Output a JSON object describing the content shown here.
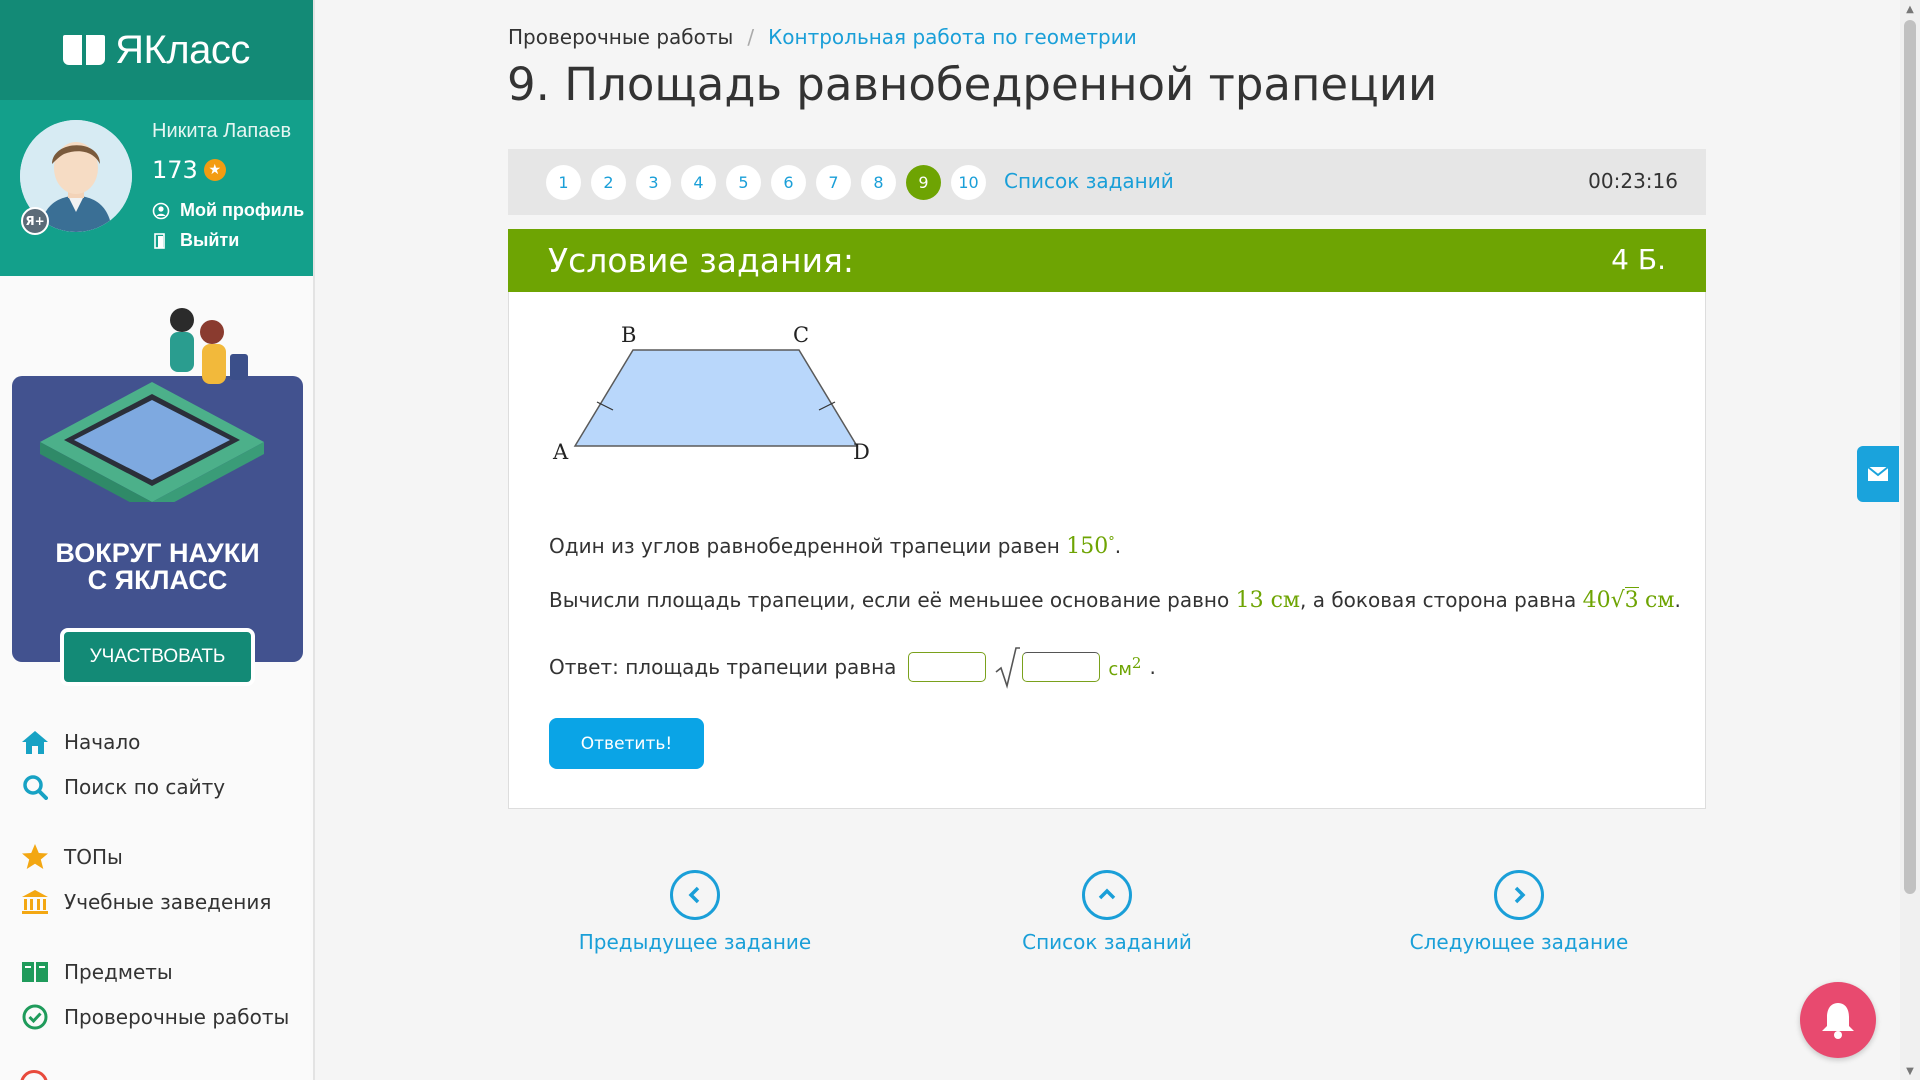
{
  "app": {
    "logo_text": "ЯКласс"
  },
  "user": {
    "name": "Никита Лапаев",
    "points": "173",
    "badge": "Я+",
    "profile_link": "Мой профиль",
    "logout_link": "Выйти"
  },
  "promo": {
    "title_line1": "ВОКРУГ НАУКИ",
    "title_line2": "С ЯКЛАСС",
    "button": "УЧАСТВОВАТЬ"
  },
  "nav": {
    "home": "Начало",
    "search": "Поиск по сайту",
    "tops": "ТОПы",
    "schools": "Учебные заведения",
    "subjects": "Предметы",
    "tests": "Проверочные работы"
  },
  "breadcrumb": {
    "root": "Проверочные работы",
    "separator": "/",
    "current": "Контрольная работа по геометрии"
  },
  "page_title": "9. Площадь равнобедренной трапеции",
  "task_nav": {
    "numbers": [
      "1",
      "2",
      "3",
      "4",
      "5",
      "6",
      "7",
      "8",
      "9",
      "10"
    ],
    "active": "9",
    "list_link": "Список заданий",
    "timer": "00:23:16"
  },
  "task": {
    "header": "Условие задания:",
    "points": "4 Б.",
    "figure_labels": {
      "A": "A",
      "B": "B",
      "C": "C",
      "D": "D"
    },
    "line1_text": "Один из углов равнобедренной трапеции равен",
    "line1_value": "150",
    "line1_degree": "°",
    "line1_end": ".",
    "line2_text": "Вычисли площадь трапеции, если её меньшее основание равно",
    "line2_value1": "13 см",
    "line2_mid": ", а боковая сторона равна",
    "line2_coef": "40",
    "line2_root": "3",
    "line2_unit": "см",
    "line2_end": ".",
    "answer_text": "Ответ: площадь трапеции равна",
    "answer_unit": "см",
    "answer_power": "2",
    "answer_end": ".",
    "submit": "Ответить!"
  },
  "bottom_nav": {
    "prev": "Предыдущее задание",
    "list": "Список заданий",
    "next": "Следующее задание"
  },
  "colors": {
    "brand": "#138a76",
    "accent": "#6ea403",
    "link": "#1a9fd8",
    "button": "#0aa4e6",
    "bell": "#e84a6f"
  },
  "icons": [
    "home-icon",
    "search-icon",
    "star-icon",
    "school-icon",
    "book-icon",
    "check-circle-icon",
    "mail-icon",
    "bell-icon",
    "chevron-left-icon",
    "chevron-up-icon",
    "chevron-right-icon",
    "profile-icon",
    "logout-icon",
    "coin-icon"
  ]
}
